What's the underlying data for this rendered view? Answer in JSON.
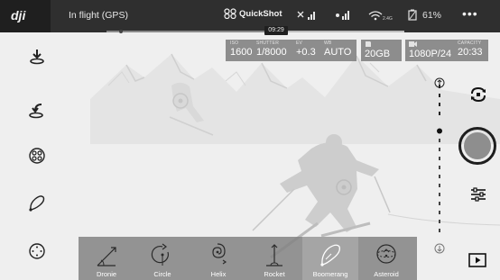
{
  "app": {
    "brand": "dji",
    "flight_status": "In flight (GPS)"
  },
  "topbar": {
    "quickshot_label": "QuickShot",
    "signal_band_label": "2.4G",
    "battery_percent": "61%",
    "more_label": "•••",
    "timer": "09:29",
    "progress": 0.54
  },
  "camera_params": {
    "iso": {
      "label": "ISO",
      "value": "1600"
    },
    "shutter": {
      "label": "SHUTTER",
      "value": "1/8000"
    },
    "ev": {
      "label": "EV",
      "value": "+0.3"
    },
    "wb": {
      "label": "WB",
      "value": "AUTO"
    },
    "storage": {
      "value": "20GB"
    },
    "resolution": {
      "value": "1080P/24"
    },
    "capacity": {
      "label": "CAPACITY",
      "value": "20:33"
    }
  },
  "left_toolbar": [
    {
      "name": "takeoff-icon"
    },
    {
      "name": "return-home-icon"
    },
    {
      "name": "intelligent-flight-icon"
    },
    {
      "name": "waypoint-icon"
    },
    {
      "name": "map-icon"
    }
  ],
  "right_toolbar": {
    "zoom_level": 0.33,
    "icons": [
      "camera-switch-icon",
      "shutter-button",
      "camera-settings-icon",
      "playback-icon"
    ]
  },
  "modes": [
    {
      "label": "Dronie",
      "icon": "dronie-icon",
      "selected": false
    },
    {
      "label": "Circle",
      "icon": "circle-icon",
      "selected": false
    },
    {
      "label": "Helix",
      "icon": "helix-icon",
      "selected": false
    },
    {
      "label": "Rocket",
      "icon": "rocket-icon",
      "selected": false
    },
    {
      "label": "Boomerang",
      "icon": "boomerang-icon",
      "selected": true
    },
    {
      "label": "Asteroid",
      "icon": "asteroid-icon",
      "selected": false
    }
  ],
  "colors": {
    "topbar": "#2f2f2f",
    "accent_dark": "#1e1e1e",
    "shutter_fill": "#8e8e8e",
    "mode_selected": "#a5a5a5"
  }
}
